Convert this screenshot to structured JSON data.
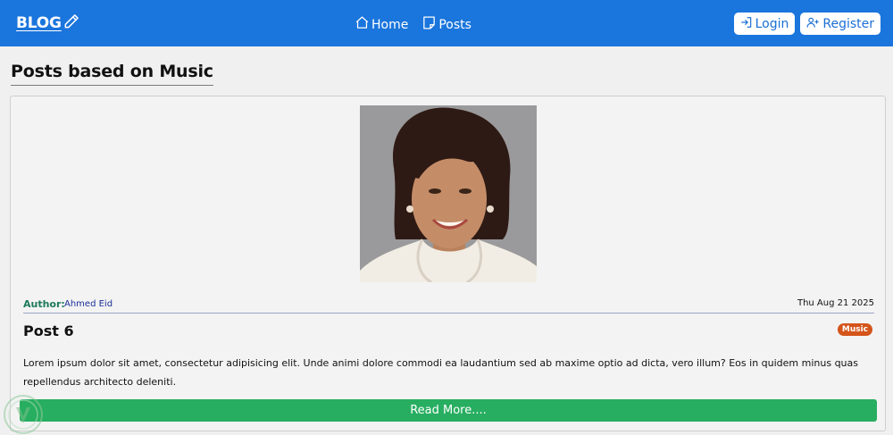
{
  "navbar": {
    "brand": "BLOG",
    "brand_icon": "pencil-icon",
    "links": [
      {
        "label": "Home",
        "icon": "home-icon"
      },
      {
        "label": "Posts",
        "icon": "posts-icon"
      }
    ],
    "auth": [
      {
        "label": "Login",
        "icon": "login-icon"
      },
      {
        "label": "Register",
        "icon": "user-plus-icon"
      }
    ],
    "background_color": "#1a75dc"
  },
  "page": {
    "title": "Posts based on Music"
  },
  "post": {
    "image_icon": "author-photo",
    "author_label": "Author:",
    "author_name": "Ahmed Eid",
    "date": "Thu Aug 21 2025",
    "title": "Post 6",
    "category": "Music",
    "category_color": "#d4541a",
    "excerpt": "Lorem ipsum dolor sit amet, consectetur adipisicing elit. Unde animi dolore commodi ea laudantium sed ab maxime optio ad dicta, vero illum? Eos in quidem minus quas repellendus architecto deleniti.",
    "read_more": "Read More....",
    "read_more_color": "#27ae60"
  }
}
